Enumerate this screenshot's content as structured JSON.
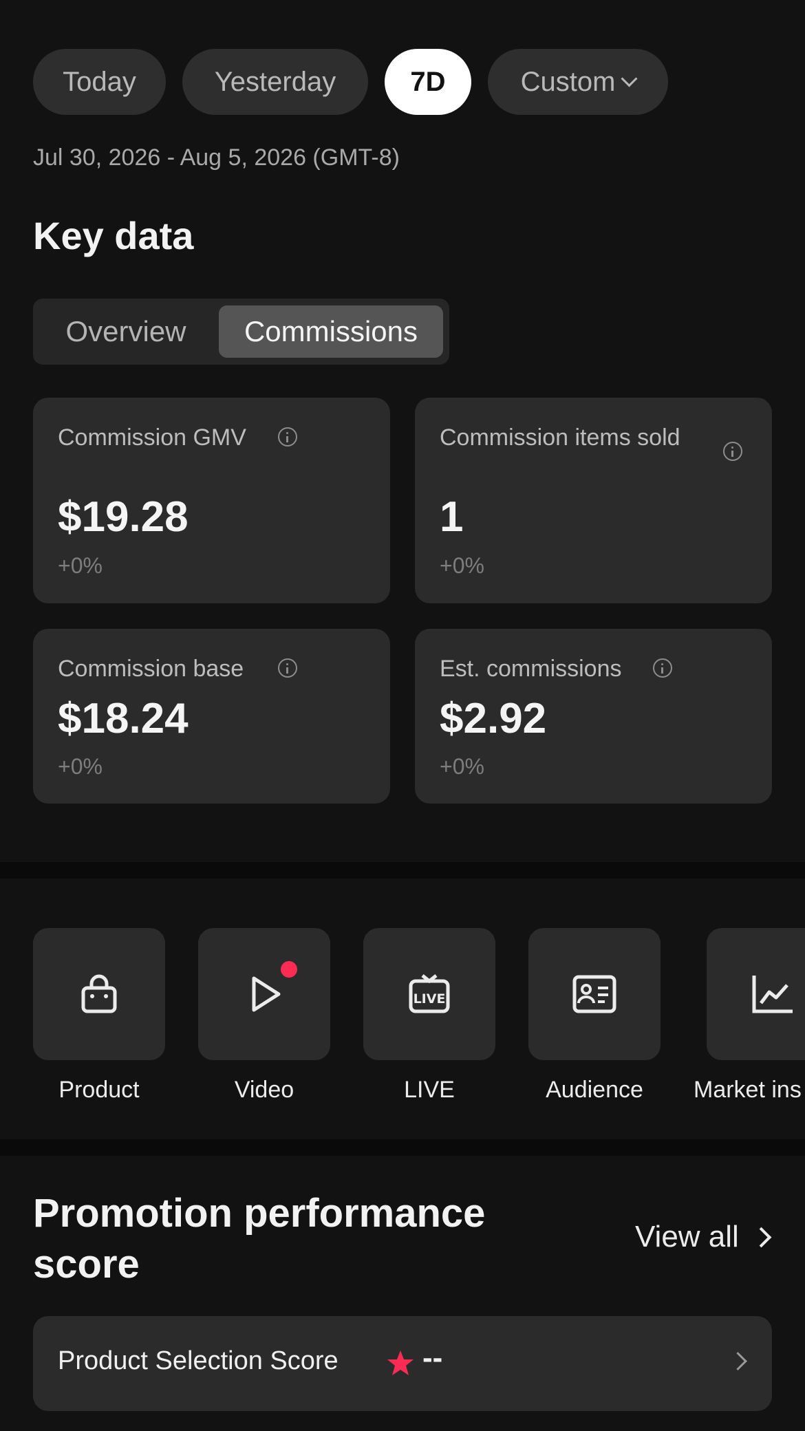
{
  "filters": {
    "today": "Today",
    "yesterday": "Yesterday",
    "seven_day": "7D",
    "custom": "Custom",
    "selected": "7D"
  },
  "date_range": "Jul 30, 2026 - Aug 5, 2026 (GMT-8)",
  "key_data": {
    "title": "Key data",
    "tabs": [
      "Overview",
      "Commissions"
    ],
    "active_tab": "Commissions",
    "metrics": [
      {
        "label": "Commission GMV",
        "value": "$19.28",
        "change": "+0%"
      },
      {
        "label": "Commission items sold",
        "value": "1",
        "change": "+0%"
      },
      {
        "label": "Commission base",
        "value": "$18.24",
        "change": "+0%"
      },
      {
        "label": "Est. commissions",
        "value": "$2.92",
        "change": "+0%"
      }
    ]
  },
  "quick_links": [
    {
      "label": "Product",
      "icon": "shopping-bag-icon"
    },
    {
      "label": "Video",
      "icon": "play-icon"
    },
    {
      "label": "LIVE",
      "icon": "live-icon"
    },
    {
      "label": "Audience",
      "icon": "id-card-icon"
    },
    {
      "label": "Market ins",
      "icon": "trend-chart-icon"
    }
  ],
  "promotion": {
    "title": "Promotion performance score",
    "view_all": "View all",
    "score_label": "Product Selection Score",
    "score_value": "--"
  },
  "colors": {
    "background": "#121212",
    "card": "#2b2b2b",
    "accent_red": "#fe2c55",
    "text": "#ececec"
  }
}
